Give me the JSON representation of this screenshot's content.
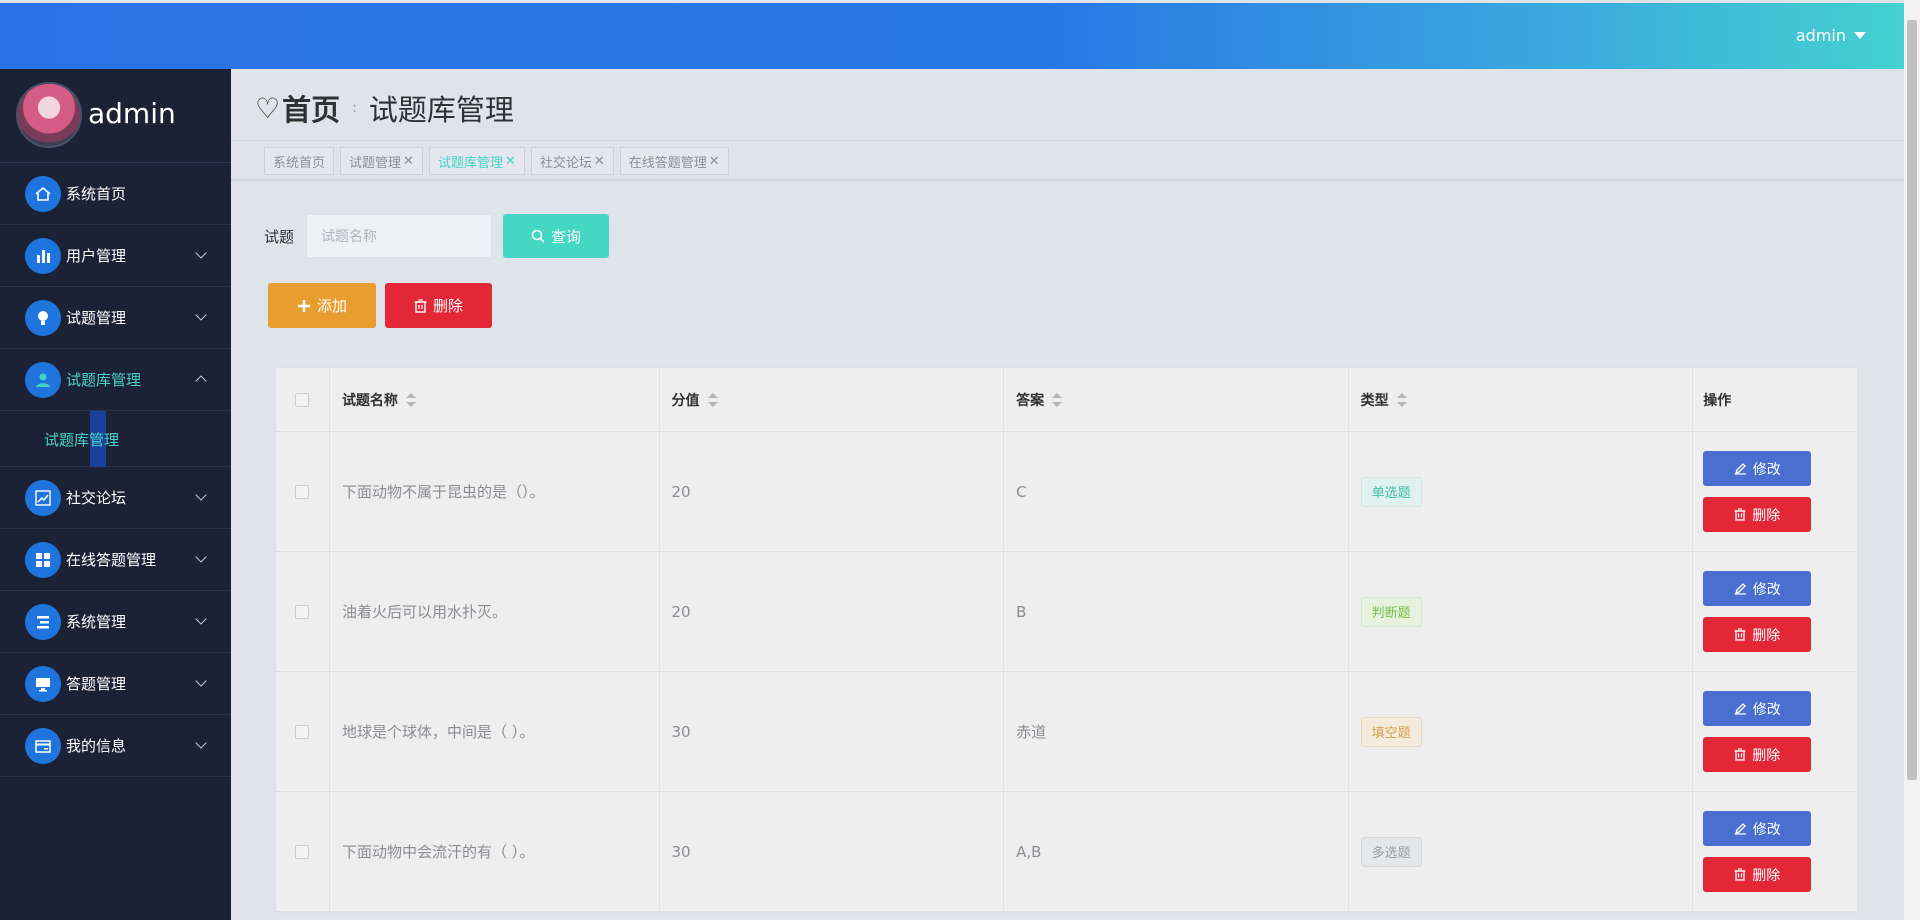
{
  "topbar": {
    "user": "admin"
  },
  "sidebar": {
    "profile_name": "admin",
    "items": [
      {
        "label": "系统首页",
        "icon": "home-icon"
      },
      {
        "label": "用户管理",
        "icon": "bar-chart-icon"
      },
      {
        "label": "试题管理",
        "icon": "bulb-icon"
      },
      {
        "label": "试题库管理",
        "icon": "user-icon"
      },
      {
        "label": "社交论坛",
        "icon": "trend-chart-icon"
      },
      {
        "label": "在线答题管理",
        "icon": "grid-icon"
      },
      {
        "label": "系统管理",
        "icon": "list-icon"
      },
      {
        "label": "答题管理",
        "icon": "monitor-icon"
      },
      {
        "label": "我的信息",
        "icon": "card-icon"
      }
    ],
    "submenu": {
      "label": "试题库管理"
    }
  },
  "breadcrumb": {
    "home": "首页",
    "separator": ":",
    "current": "试题库管理"
  },
  "tags": [
    {
      "label": "系统首页"
    },
    {
      "label": "试题管理"
    },
    {
      "label": "试题库管理"
    },
    {
      "label": "社交论坛"
    },
    {
      "label": "在线答题管理"
    }
  ],
  "search": {
    "label": "试题",
    "placeholder": "试题名称",
    "button": "查询"
  },
  "actions": {
    "add": "添加",
    "delete": "删除"
  },
  "table": {
    "headers": {
      "name": "试题名称",
      "score": "分值",
      "answer": "答案",
      "type": "类型",
      "ops": "操作"
    },
    "rows": [
      {
        "name": "下面动物不属于昆虫的是（）。",
        "score": "20",
        "answer": "C",
        "type": "单选题"
      },
      {
        "name": "油着火后可以用水扑灭。",
        "score": "20",
        "answer": "B",
        "type": "判断题"
      },
      {
        "name": "地球是个球体，中间是（ ）。",
        "score": "30",
        "answer": "赤道",
        "type": "填空题"
      },
      {
        "name": "下面动物中会流汗的有（ ）。",
        "score": "30",
        "answer": "A,B",
        "type": "多选题"
      }
    ],
    "edit_label": "修改",
    "delete_label": "删除"
  },
  "colors": {
    "accent": "#46d3c7",
    "primary": "#2a73e6",
    "danger": "#e32737",
    "warning": "#e99d2f"
  }
}
